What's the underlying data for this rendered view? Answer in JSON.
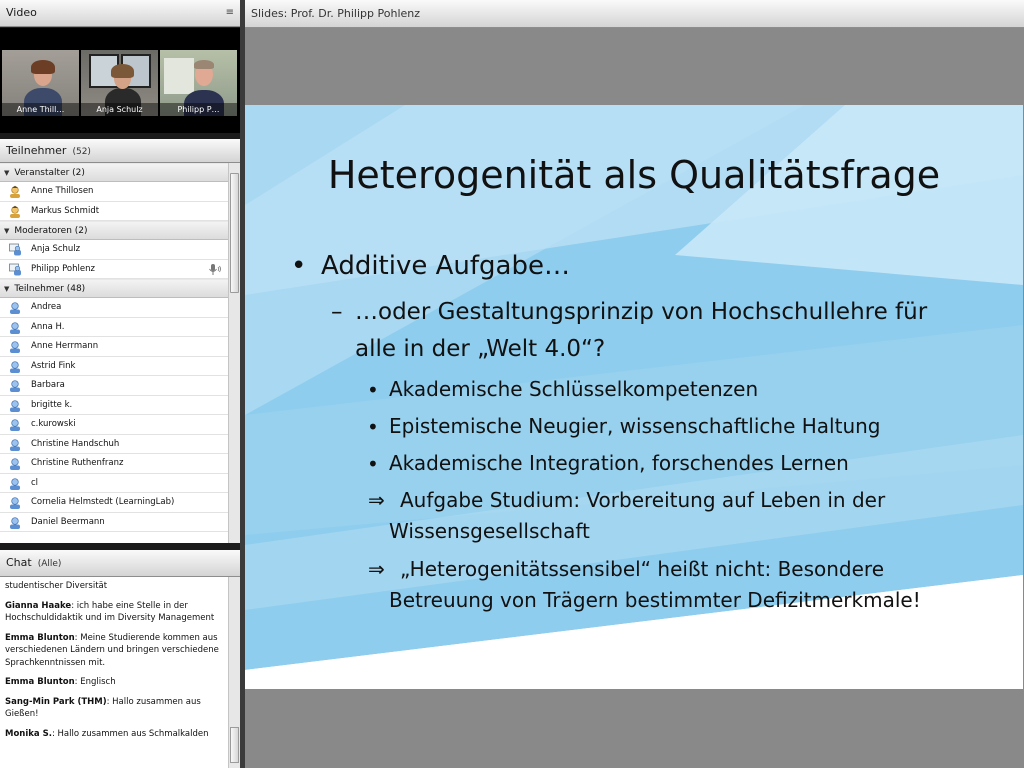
{
  "video": {
    "title": "Video",
    "participants": [
      "Anne Thill…",
      "Anja Schulz",
      "Philipp P…"
    ]
  },
  "attendees": {
    "title": "Teilnehmer",
    "count": "(52)",
    "groups": [
      {
        "label": "Veranstalter (2)",
        "members": [
          "Anne Thillosen",
          "Markus Schmidt"
        ]
      },
      {
        "label": "Moderatoren (2)",
        "members": [
          "Anja Schulz",
          "Philipp Pohlenz"
        ]
      },
      {
        "label": "Teilnehmer (48)",
        "members": [
          "Andrea",
          "Anna H.",
          "Anne Herrmann",
          "Astrid Fink",
          "Barbara",
          "brigitte k.",
          "c.kurowski",
          "Christine Handschuh",
          "Christine Ruthenfranz",
          "cl",
          "Cornelia Helmstedt (LearningLab)",
          "Daniel Beermann"
        ]
      }
    ]
  },
  "chat": {
    "title": "Chat",
    "filter": "(Alle)",
    "messages": [
      {
        "sender": "",
        "text": "studentischer Diversität"
      },
      {
        "sender": "Gianna Haake",
        "text": ": ich habe eine Stelle in der Hochschuldidaktik und im Diversity Management"
      },
      {
        "sender": "Emma Blunton",
        "text": ": Meine Studierende kommen aus verschiedenen Ländern und bringen verschiedene Sprachkenntnissen mit."
      },
      {
        "sender": "Emma Blunton",
        "text": ": Englisch"
      },
      {
        "sender": "Sang-Min Park (THM)",
        "text": ": Hallo zusammen aus Gießen!"
      },
      {
        "sender": "Monika S.",
        "text": ": Hallo zusammen aus Schmalkalden"
      }
    ]
  },
  "slides": {
    "header": "Slides: Prof. Dr. Philipp Pohlenz",
    "title": "Heterogenität als Qualitätsfrage",
    "bullet1": "Additive Aufgabe…",
    "dash1_line1": "…oder Gestaltungsprinzip von Hochschullehre für",
    "dash1_line2": "alle in der „Welt 4.0“?",
    "sub1": "Akademische Schlüsselkompetenzen",
    "sub2": "Epistemische Neugier, wissenschaftliche Haltung",
    "sub3": "Akademische Integration, forschendes Lernen",
    "arrow1_line1": "Aufgabe Studium: Vorbereitung auf Leben in der",
    "arrow1_line2": "Wissensgesellschaft",
    "arrow2_line1": "„Heterogenitätssensibel“ heißt nicht: Besondere",
    "arrow2_line2": "Betreuung von Trägern bestimmter Defizitmerkmale!"
  },
  "colors": {
    "slide_blue": "#8fcdee",
    "slide_light": "#d3ecf8",
    "header_bg": "#e4e4e4"
  }
}
